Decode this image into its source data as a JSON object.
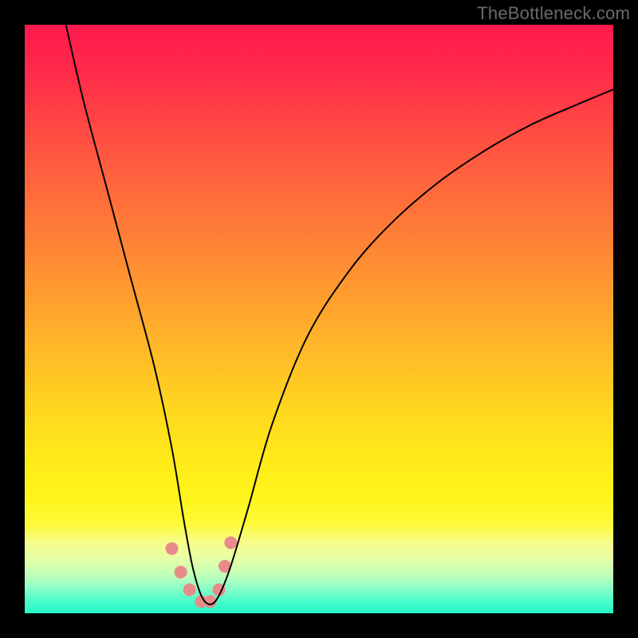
{
  "watermark": "TheBottleneck.com",
  "chart_data": {
    "type": "line",
    "title": "",
    "xlabel": "",
    "ylabel": "",
    "xlim": [
      0,
      100
    ],
    "ylim": [
      0,
      100
    ],
    "grid": false,
    "legend": "none",
    "series": [
      {
        "name": "bottleneck-curve",
        "x": [
          7,
          10,
          14,
          18,
          22,
          25,
          27,
          28.5,
          30,
          31.5,
          33,
          35,
          38,
          42,
          48,
          55,
          62,
          70,
          78,
          86,
          94,
          100
        ],
        "values": [
          100,
          87,
          72,
          57,
          42,
          28,
          16,
          8,
          3,
          1.5,
          3,
          8,
          18,
          32,
          47,
          58,
          66,
          73,
          78.5,
          83,
          86.5,
          89
        ]
      }
    ],
    "markers": {
      "name": "highlight-dots",
      "x": [
        25.0,
        26.5,
        28.0,
        30.0,
        31.5,
        33.0,
        34.0,
        35.0
      ],
      "values": [
        11.0,
        7.0,
        4.0,
        2.0,
        2.0,
        4.0,
        8.0,
        12.0
      ],
      "color": "#e88b8b",
      "radius": 8
    }
  }
}
